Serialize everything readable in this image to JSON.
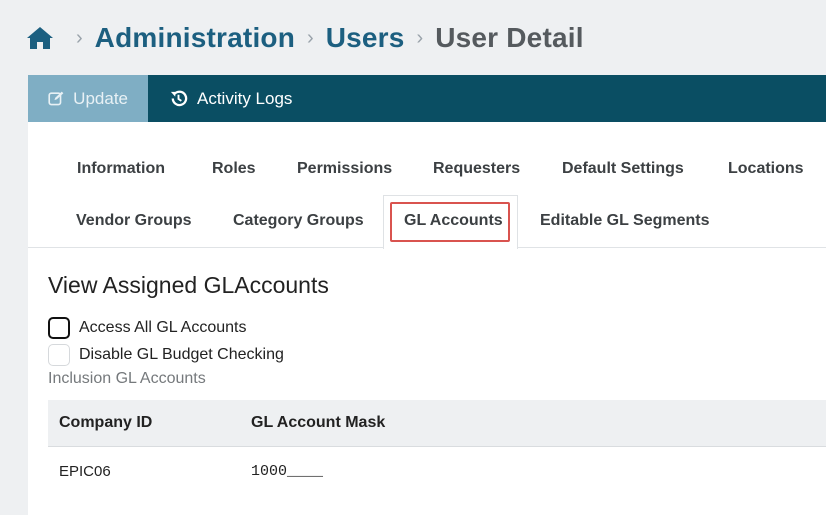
{
  "breadcrumb": {
    "home_icon": "home-icon",
    "items": [
      "Administration",
      "Users"
    ],
    "current": "User Detail"
  },
  "toolbar": {
    "update_label": "Update",
    "update_icon": "edit-icon",
    "activity_logs_label": "Activity Logs",
    "activity_logs_icon": "history-icon",
    "bg_color": "#0a4e63",
    "update_bg_color": "#7faec4"
  },
  "tabs": {
    "row1": [
      "Information",
      "Roles",
      "Permissions",
      "Requesters",
      "Default Settings",
      "Locations"
    ],
    "row2": [
      "Vendor Groups",
      "Category Groups",
      "GL Accounts",
      "Editable GL Segments"
    ],
    "active": "GL Accounts",
    "highlight_color": "#d9534f"
  },
  "section": {
    "title": "View Assigned GLAccounts",
    "access_all_label": "Access All GL Accounts",
    "access_all_checked": false,
    "disable_budget_label": "Disable GL Budget Checking",
    "disable_budget_checked": false,
    "inclusion_label": "Inclusion GL Accounts"
  },
  "table": {
    "headers": [
      "Company ID",
      "GL Account Mask"
    ],
    "rows": [
      [
        "EPIC06",
        "1000____"
      ]
    ]
  },
  "colors": {
    "link": "#1c5f80",
    "page_bg": "#eef0f2"
  }
}
